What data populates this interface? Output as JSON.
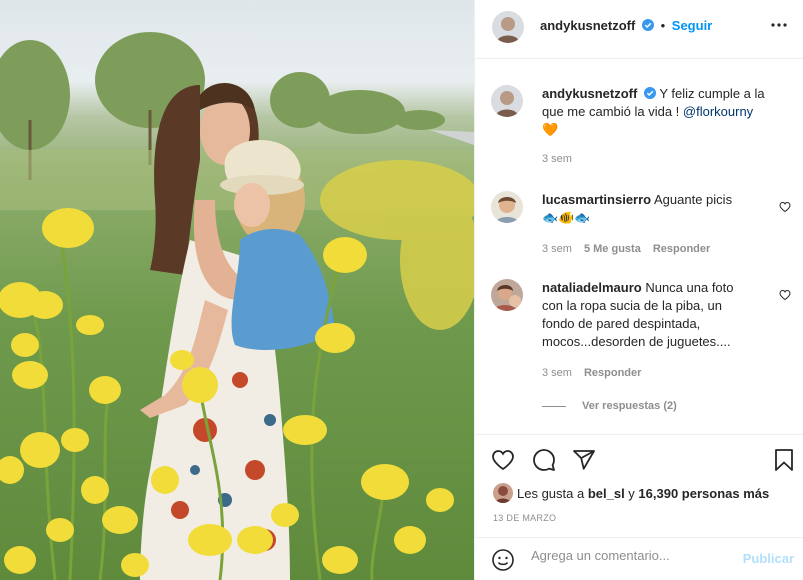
{
  "post": {
    "author": "andykusnetzoff",
    "follow_label": "Seguir",
    "caption_text": "Y feliz cumple a la que me cambió la vida ! ",
    "caption_mention": "@florkourny",
    "caption_emoji": "🧡",
    "caption_time": "3 sem"
  },
  "comments": [
    {
      "username": "lucasmartinsierro",
      "text": "Aguante picis",
      "emoji": "🐟🐠🐟",
      "time": "3 sem",
      "likes": "5 Me gusta",
      "reply_label": "Responder"
    },
    {
      "username": "nataliadelmauro",
      "text_line1": "Nunca una foto",
      "text_line2": "con la ropa sucia de la piba, un",
      "text_line3": "fondo de pared despintada,",
      "text_line4": "mocos...desorden de juguetes....",
      "time": "3 sem",
      "reply_label": "Responder",
      "view_replies": "Ver respuestas (2)"
    }
  ],
  "likes": {
    "prefix": "Les gusta a ",
    "user": "bel_sl",
    "middle": " y ",
    "count": "16,390 personas más"
  },
  "date": "13 DE MARZO",
  "add_comment": {
    "placeholder": "Agrega un comentario...",
    "publish_label": "Publicar"
  },
  "colors": {
    "link_blue": "#0095f6",
    "publish_disabled": "#b2dffc",
    "muted": "#8e8e8e",
    "heart_orange": "#f4772e"
  },
  "icons": [
    "verified-badge-icon",
    "more-options-icon",
    "heart-icon",
    "comment-icon",
    "share-icon",
    "bookmark-icon",
    "emoji-icon"
  ]
}
